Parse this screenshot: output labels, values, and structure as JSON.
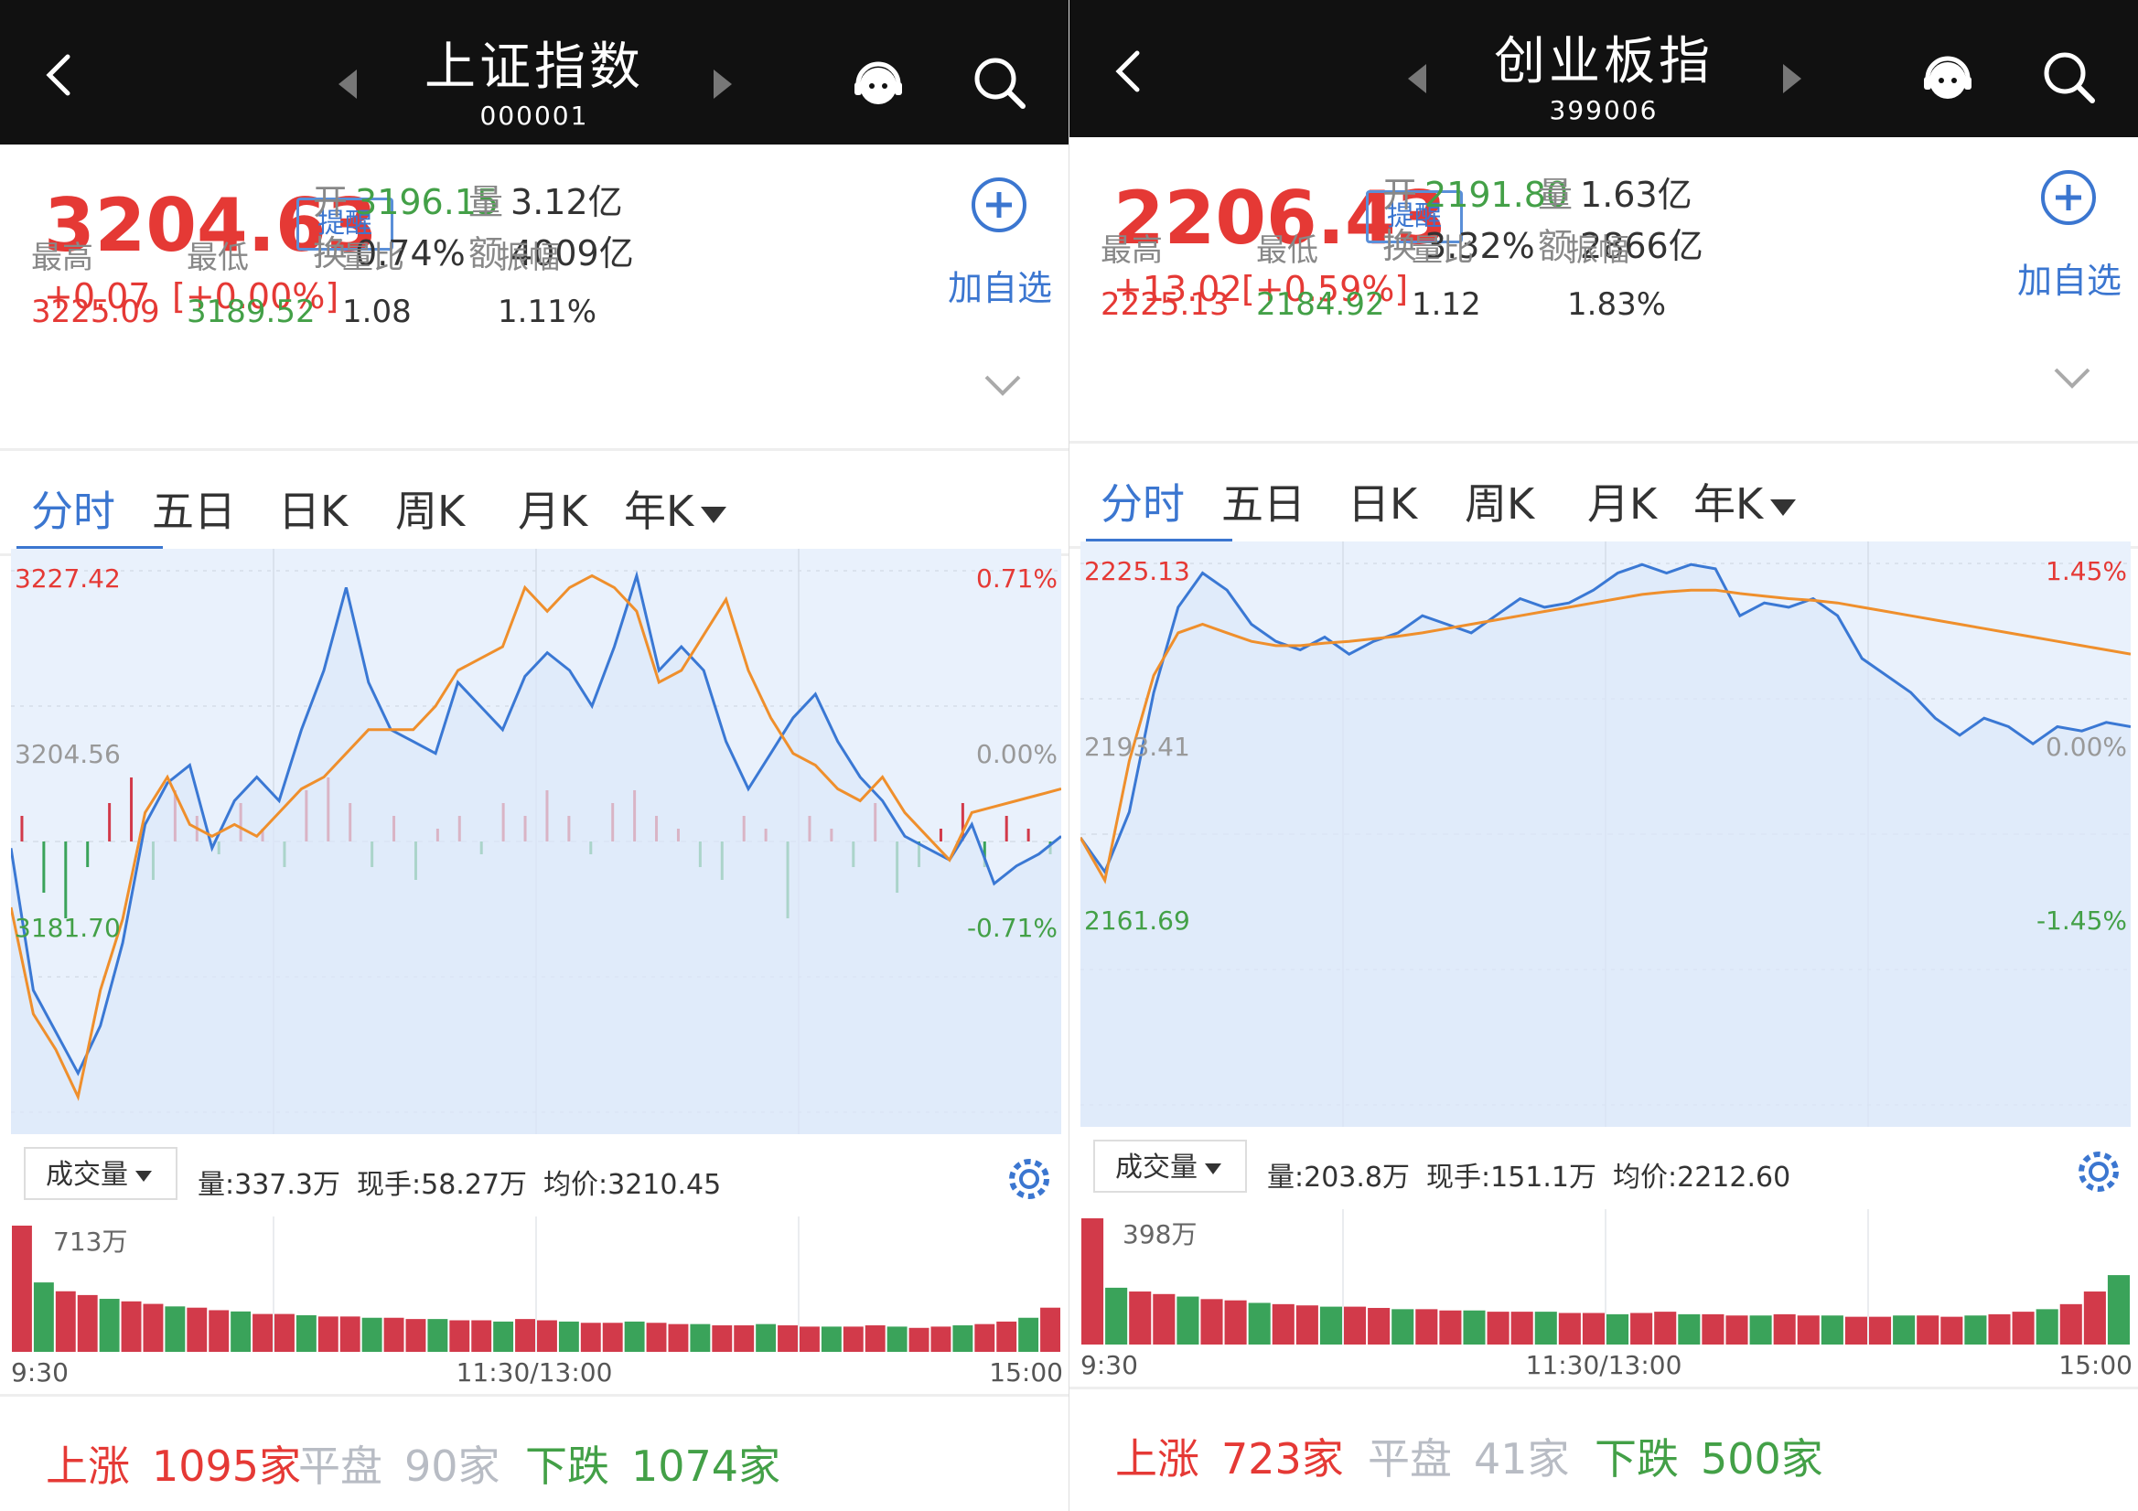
{
  "panels": [
    {
      "name": "上证指数",
      "code": "000001",
      "price": "3204.63",
      "remind_label": "提醒",
      "change": "+0.07",
      "change_pct": "[+0.00%]",
      "open_label": "开",
      "open": "3196.15",
      "volume_label": "量",
      "volume": "3.12亿",
      "turnover_label": "换",
      "turnover": "0.74%",
      "amount_label": "额",
      "amount": "4009亿",
      "add_label": "加自选",
      "high_label": "最高",
      "high": "3225.09",
      "low_label": "最低",
      "low": "3189.52",
      "ratio_label": "量比",
      "ratio": "1.08",
      "amp_label": "振幅",
      "amp": "1.11%",
      "tabs": [
        "分时",
        "五日",
        "日K",
        "周K",
        "月K",
        "年K"
      ],
      "chart_data": {
        "type": "line",
        "y_top": "3227.42",
        "y_mid": "3204.56",
        "y_bot": "3181.70",
        "pct_top": "0.71%",
        "pct_mid": "0.00%",
        "pct_bot": "-0.71%",
        "ylim": [
          3181.7,
          3227.42
        ],
        "series": [
          {
            "color": "#3a78d4",
            "values": [
              3204.0,
              3192.0,
              3188.5,
              3185.0,
              3189.0,
              3196.0,
              3206.0,
              3209.5,
              3211.0,
              3204.0,
              3208.0,
              3210.0,
              3208.0,
              3214.0,
              3219.0,
              3226.0,
              3218.0,
              3214.0,
              3213.0,
              3212.0,
              3218.0,
              3216.0,
              3214.0,
              3218.5,
              3220.5,
              3219.0,
              3216.0,
              3221.0,
              3227.0,
              3219.0,
              3221.0,
              3219.0,
              3213.0,
              3209.0,
              3212.0,
              3215.0,
              3217.0,
              3213.0,
              3210.0,
              3208.0,
              3205.0,
              3204.0,
              3203.0,
              3206.0,
              3201.0,
              3202.5,
              3203.5,
              3205.0
            ]
          },
          {
            "color": "#ef8f2c",
            "values": [
              3199.0,
              3190.0,
              3187.0,
              3183.0,
              3192.0,
              3198.0,
              3207.0,
              3210.0,
              3206.0,
              3205.0,
              3206.0,
              3205.0,
              3207.0,
              3209.0,
              3210.0,
              3212.0,
              3214.0,
              3214.0,
              3214.0,
              3216.0,
              3219.0,
              3220.0,
              3221.0,
              3226.0,
              3224.0,
              3226.0,
              3227.0,
              3226.0,
              3224.0,
              3218.0,
              3219.0,
              3222.0,
              3225.0,
              3219.0,
              3215.0,
              3212.0,
              3211.0,
              3209.0,
              3208.0,
              3210.0,
              3207.0,
              3205.0,
              3203.0,
              3207.0,
              3207.5,
              3208.0,
              3208.5,
              3209.0
            ]
          }
        ],
        "net_flow": [
          2,
          -4,
          -6,
          -2,
          3,
          5,
          -3,
          4,
          2,
          -1,
          3,
          1,
          -2,
          4,
          5,
          3,
          -2,
          2,
          -3,
          1,
          2,
          -1,
          3,
          2,
          4,
          2,
          -1,
          3,
          4,
          2,
          1,
          -2,
          -3,
          2,
          1,
          -6,
          2,
          1,
          -2,
          3,
          -4,
          -2,
          1,
          3,
          -2,
          2,
          1,
          -1
        ]
      },
      "vol_label": "成交量",
      "vol_info": [
        "量:337.3万",
        "现手:58.27万",
        "均价:3210.45"
      ],
      "vol_max": "713万",
      "vol_data": [
        1.0,
        0.55,
        0.48,
        0.45,
        0.42,
        0.4,
        0.38,
        0.36,
        0.35,
        0.33,
        0.32,
        0.3,
        0.3,
        0.29,
        0.28,
        0.28,
        0.27,
        0.27,
        0.26,
        0.26,
        0.25,
        0.25,
        0.24,
        0.26,
        0.25,
        0.24,
        0.23,
        0.23,
        0.24,
        0.23,
        0.22,
        0.22,
        0.21,
        0.21,
        0.22,
        0.21,
        0.2,
        0.2,
        0.2,
        0.21,
        0.2,
        0.19,
        0.2,
        0.21,
        0.22,
        0.24,
        0.27,
        0.35
      ],
      "times": [
        "9:30",
        "11:30/13:00",
        "15:00"
      ],
      "up_label": "上涨",
      "up": "1095家",
      "flat_label": "平盘",
      "flat": "90家",
      "down_label": "下跌",
      "down": "1074家"
    },
    {
      "name": "创业板指",
      "code": "399006",
      "price": "2206.43",
      "remind_label": "提醒",
      "change": "+13.02",
      "change_pct": "[+0.59%]",
      "open_label": "开",
      "open": "2191.80",
      "volume_label": "量",
      "volume": "1.63亿",
      "turnover_label": "换",
      "turnover": "3.32%",
      "amount_label": "额",
      "amount": "2866亿",
      "add_label": "加自选",
      "high_label": "最高",
      "high": "2225.13",
      "low_label": "最低",
      "low": "2184.92",
      "ratio_label": "量比",
      "ratio": "1.12",
      "amp_label": "振幅",
      "amp": "1.83%",
      "tabs": [
        "分时",
        "五日",
        "日K",
        "周K",
        "月K",
        "年K"
      ],
      "chart_data": {
        "type": "line",
        "y_top": "2225.13",
        "y_mid": "2193.41",
        "y_bot": "2161.69",
        "pct_top": "1.45%",
        "pct_mid": "0.00%",
        "pct_bot": "-1.45%",
        "ylim": [
          2161.69,
          2225.13
        ],
        "series": [
          {
            "color": "#3a78d4",
            "values": [
              2193.0,
              2189.0,
              2196.0,
              2210.0,
              2220.0,
              2224.0,
              2222.0,
              2218.0,
              2216.0,
              2215.0,
              2216.5,
              2214.5,
              2216.0,
              2217.0,
              2219.0,
              2218.0,
              2217.0,
              2219.0,
              2221.0,
              2220.0,
              2220.5,
              2222.0,
              2224.0,
              2225.0,
              2224.0,
              2225.0,
              2224.5,
              2219.0,
              2220.5,
              2220.0,
              2221.0,
              2219.0,
              2214.0,
              2212.0,
              2210.0,
              2207.0,
              2205.0,
              2207.0,
              2206.0,
              2204.0,
              2206.0,
              2205.5,
              2206.5,
              2206.0
            ]
          },
          {
            "color": "#ef8f2c",
            "values": [
              2193.0,
              2188.0,
              2202.0,
              2212.0,
              2217.0,
              2218.0,
              2217.0,
              2216.0,
              2215.5,
              2215.5,
              2215.8,
              2216.0,
              2216.3,
              2216.6,
              2217.0,
              2217.5,
              2218.0,
              2218.5,
              2219.0,
              2219.5,
              2220.0,
              2220.5,
              2221.0,
              2221.5,
              2221.8,
              2222.0,
              2222.0,
              2221.6,
              2221.3,
              2221.0,
              2220.8,
              2220.5,
              2220.0,
              2219.5,
              2219.0,
              2218.5,
              2218.0,
              2217.5,
              2217.0,
              2216.5,
              2216.0,
              2215.5,
              2215.0,
              2214.5
            ]
          }
        ],
        "net_flow": []
      },
      "vol_label": "成交量",
      "vol_info": [
        "量:203.8万",
        "现手:151.1万",
        "均价:2212.60"
      ],
      "vol_max": "398万",
      "vol_data": [
        1.0,
        0.45,
        0.42,
        0.4,
        0.38,
        0.36,
        0.35,
        0.33,
        0.32,
        0.31,
        0.3,
        0.3,
        0.29,
        0.28,
        0.28,
        0.27,
        0.27,
        0.26,
        0.26,
        0.26,
        0.25,
        0.25,
        0.24,
        0.25,
        0.26,
        0.24,
        0.24,
        0.23,
        0.23,
        0.24,
        0.23,
        0.23,
        0.22,
        0.22,
        0.23,
        0.23,
        0.22,
        0.23,
        0.24,
        0.26,
        0.28,
        0.32,
        0.42,
        0.55
      ],
      "times": [
        "9:30",
        "11:30/13:00",
        "15:00"
      ],
      "up_label": "上涨",
      "up": "723家",
      "flat_label": "平盘",
      "flat": "41家",
      "down_label": "下跌",
      "down": "500家"
    }
  ]
}
